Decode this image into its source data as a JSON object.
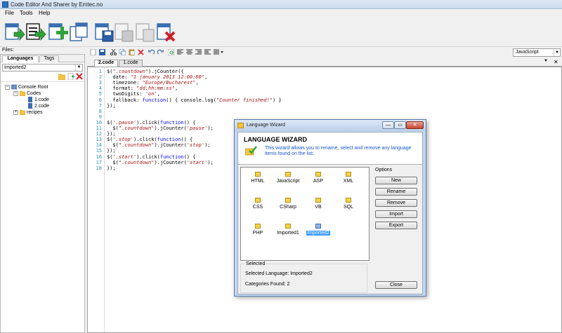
{
  "window": {
    "title": "Code Editor And Sharer by Emtec.no"
  },
  "menu": {
    "file": "File",
    "tools": "Tools",
    "help": "Help"
  },
  "sidebar": {
    "files_label": "Files:",
    "tabs": {
      "languages": "Languages",
      "tags": "Tags"
    },
    "selected_language": "Imported2",
    "tree": {
      "root": "Console Root",
      "codes": "Codes",
      "file1": "1.code",
      "file2": "2.code",
      "recipes": "recipes"
    }
  },
  "editor": {
    "language": "JavaScript",
    "tabs": {
      "active": "2.code",
      "other": "1.code"
    },
    "tab_controls": {
      "dropdown": "▼",
      "close": "✕"
    },
    "lines": [
      {
        "n": "1",
        "segs": [
          {
            "t": "$(",
            "c": ""
          },
          {
            "t": "\".countdown\"",
            "c": "str"
          },
          {
            "t": ").jCounter({",
            "c": ""
          }
        ]
      },
      {
        "n": "2",
        "segs": [
          {
            "t": "  date: ",
            "c": ""
          },
          {
            "t": "\"1 january 2013 12:00:00\"",
            "c": "str"
          },
          {
            "t": ",",
            "c": ""
          }
        ]
      },
      {
        "n": "3",
        "segs": [
          {
            "t": "  timezone: ",
            "c": ""
          },
          {
            "t": "\"Europe/Bucharest\"",
            "c": "str"
          },
          {
            "t": ",",
            "c": ""
          }
        ]
      },
      {
        "n": "4",
        "segs": [
          {
            "t": "  format: ",
            "c": ""
          },
          {
            "t": "\"dd:hh:mm:ss\"",
            "c": "str"
          },
          {
            "t": ",",
            "c": ""
          }
        ]
      },
      {
        "n": "5",
        "segs": [
          {
            "t": "  twoDigits: ",
            "c": ""
          },
          {
            "t": "'on'",
            "c": "str"
          },
          {
            "t": ",",
            "c": ""
          }
        ]
      },
      {
        "n": "6",
        "segs": [
          {
            "t": "  fallback: ",
            "c": ""
          },
          {
            "t": "function",
            "c": "kw"
          },
          {
            "t": "() { console.log(",
            "c": ""
          },
          {
            "t": "\"Counter finished!\"",
            "c": "str"
          },
          {
            "t": ") }",
            "c": ""
          }
        ]
      },
      {
        "n": "7",
        "segs": [
          {
            "t": "});",
            "c": ""
          }
        ]
      },
      {
        "n": "8",
        "segs": []
      },
      {
        "n": "9",
        "segs": []
      },
      {
        "n": "10",
        "segs": [
          {
            "t": "$(",
            "c": ""
          },
          {
            "t": "'.pause'",
            "c": "str"
          },
          {
            "t": ").click(",
            "c": ""
          },
          {
            "t": "function",
            "c": "kw"
          },
          {
            "t": "() {",
            "c": ""
          }
        ]
      },
      {
        "n": "11",
        "segs": [
          {
            "t": "  $(",
            "c": ""
          },
          {
            "t": "\".countdown\"",
            "c": "str"
          },
          {
            "t": ").jCounter(",
            "c": ""
          },
          {
            "t": "'pause'",
            "c": "str"
          },
          {
            "t": ");",
            "c": ""
          }
        ]
      },
      {
        "n": "12",
        "segs": [
          {
            "t": "});",
            "c": ""
          }
        ]
      },
      {
        "n": "13",
        "segs": [
          {
            "t": "$(",
            "c": ""
          },
          {
            "t": "'.stop'",
            "c": "str"
          },
          {
            "t": ").click(",
            "c": ""
          },
          {
            "t": "function",
            "c": "kw"
          },
          {
            "t": "() {",
            "c": ""
          }
        ]
      },
      {
        "n": "14",
        "segs": [
          {
            "t": "  $(",
            "c": ""
          },
          {
            "t": "\".countdown\"",
            "c": "str"
          },
          {
            "t": ").jCounter(",
            "c": ""
          },
          {
            "t": "'stop'",
            "c": "str"
          },
          {
            "t": ");",
            "c": ""
          }
        ]
      },
      {
        "n": "15",
        "segs": [
          {
            "t": "});",
            "c": ""
          }
        ]
      },
      {
        "n": "16",
        "segs": [
          {
            "t": "$(",
            "c": ""
          },
          {
            "t": "'.start'",
            "c": "str"
          },
          {
            "t": ").click(",
            "c": ""
          },
          {
            "t": "function",
            "c": "kw"
          },
          {
            "t": "() {",
            "c": ""
          }
        ]
      },
      {
        "n": "17",
        "segs": [
          {
            "t": "  $(",
            "c": ""
          },
          {
            "t": "\".countdown\"",
            "c": "str"
          },
          {
            "t": ").jCounter(",
            "c": ""
          },
          {
            "t": "'start'",
            "c": "str"
          },
          {
            "t": ");",
            "c": ""
          }
        ]
      },
      {
        "n": "18",
        "segs": [
          {
            "t": "});",
            "c": ""
          }
        ]
      }
    ]
  },
  "dialog": {
    "title": "Language Wizard",
    "window_buttons": {
      "minimize": "—",
      "maximize": "▭",
      "close": "✕"
    },
    "heading": "LANGUAGE WIZARD",
    "description": "This wizard allows you to rename, select and remove any language items found on the list.",
    "languages": [
      "HTML",
      "JavaScript",
      "ASP",
      "XML",
      "CSS",
      "CSharp",
      "VB",
      "SQL",
      "PHP",
      "Imported1",
      "Imported2"
    ],
    "selected_index": 10,
    "options_label": "Options",
    "buttons": {
      "new": "New",
      "rename": "Rename",
      "remove": "Remove",
      "import": "Import",
      "export": "Export",
      "close": "Close"
    },
    "selected_title": "Selected",
    "selected_language": "Selected Language: Imported2",
    "categories_found": "Categories Found: 2"
  },
  "colors": {
    "string": "#a31515",
    "keyword": "#0000ff",
    "line_number": "#2b91af",
    "description": "#1656c8",
    "selection": "#3399ff"
  }
}
